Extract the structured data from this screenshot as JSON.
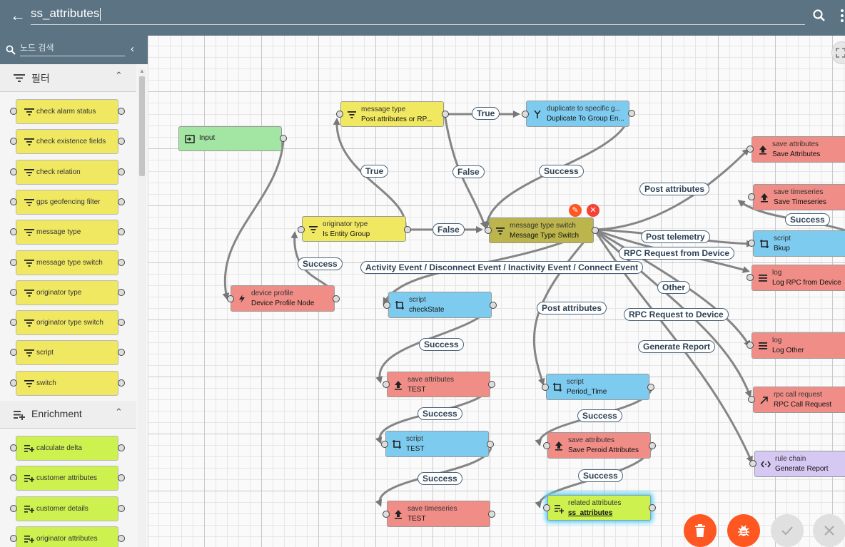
{
  "header": {
    "title": "ss_attributes"
  },
  "sidebar": {
    "search_placeholder": "노드 검색",
    "sections": [
      {
        "label": "필터",
        "items": [
          "check alarm status",
          "check existence fields",
          "check relation",
          "gps geofencing filter",
          "message type",
          "message type switch",
          "originator type",
          "originator type switch",
          "script",
          "switch"
        ]
      },
      {
        "label": "Enrichment",
        "items": [
          "calculate delta",
          "customer attributes",
          "customer details",
          "originator attributes"
        ]
      }
    ]
  },
  "nodes": [
    {
      "id": "input",
      "single": "Input"
    },
    {
      "id": "msgtype",
      "type": "message type",
      "name": "Post attributes or RP..."
    },
    {
      "id": "dup",
      "type": "duplicate to specific g...",
      "name": "Duplicate To Group En..."
    },
    {
      "id": "origtype",
      "type": "originator type",
      "name": "Is Entity Group"
    },
    {
      "id": "switch",
      "type": "message type switch",
      "name": "Message Type Switch"
    },
    {
      "id": "devprof",
      "type": "device profile",
      "name": "Device Profile Node"
    },
    {
      "id": "checkstate",
      "type": "script",
      "name": "checkState"
    },
    {
      "id": "saveattr_test",
      "type": "save attributes",
      "name": "TEST"
    },
    {
      "id": "script_test",
      "type": "script",
      "name": "TEST"
    },
    {
      "id": "savets_test",
      "type": "save timeseries",
      "name": "TEST"
    },
    {
      "id": "period",
      "type": "script",
      "name": "Period_Time"
    },
    {
      "id": "saveperoid",
      "type": "save attributes",
      "name": "Save Peroid Attributes"
    },
    {
      "id": "related",
      "type": "related attributes",
      "name": "ss_attributes"
    },
    {
      "id": "saveattr",
      "type": "save attributes",
      "name": "Save Attributes"
    },
    {
      "id": "savets",
      "type": "save timeseries",
      "name": "Save Timeseries"
    },
    {
      "id": "bkup",
      "type": "script",
      "name": "Bkup"
    },
    {
      "id": "logrpc",
      "type": "log",
      "name": "Log RPC from Device"
    },
    {
      "id": "logother",
      "type": "log",
      "name": "Log Other"
    },
    {
      "id": "rpccall",
      "type": "rpc call request",
      "name": "RPC Call Request"
    },
    {
      "id": "rulechain",
      "type": "rule chain",
      "name": "Generate Report"
    }
  ],
  "edge_labels": {
    "true1": "True",
    "true2": "True",
    "false1": "False",
    "false2": "False",
    "success_dup": "Success",
    "success_dev": "Success",
    "post_attr": "Post attributes",
    "success_ts": "Success",
    "post_tel": "Post telemetry",
    "rpc_from": "RPC Request from Device",
    "activity": "Activity Event / Disconnect Event / Inactivity Event / Connect Event",
    "other": "Other",
    "post_attr2": "Post attributes",
    "rpc_to": "RPC Request to Device",
    "gen_report": "Generate Report",
    "success_cs": "Success",
    "success_sa": "Success",
    "success_sc": "Success",
    "success_pt": "Success",
    "success_sp": "Success"
  },
  "colors": {
    "header": "#5b7382",
    "filter": "#f1e861",
    "enrichment": "#cdf14e",
    "action": "#f08d87",
    "transformation": "#7ecbf0",
    "input": "#a3e5a3",
    "flow": "#d5c8f2",
    "fab_red": "#ff5722"
  }
}
